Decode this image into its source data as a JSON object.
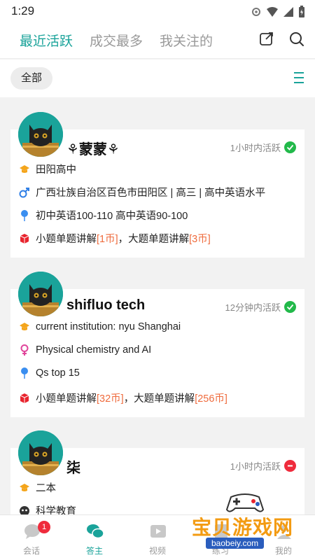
{
  "status_bar": {
    "time": "1:29"
  },
  "top_nav": {
    "tabs": [
      {
        "label": "最近活跃",
        "active": true
      },
      {
        "label": "成交最多",
        "active": false
      },
      {
        "label": "我关注的",
        "active": false
      }
    ],
    "share_icon": "share-icon",
    "search_icon": "search-icon"
  },
  "filter": {
    "chip_label": "全部",
    "menu_icon": "list-icon"
  },
  "colors": {
    "accent": "#1aa39a",
    "online": "#22b94a",
    "offline": "#ef2b3c",
    "price": "#ef6b3d"
  },
  "cards": [
    {
      "name": "⚘蒙蒙⚘",
      "active_time": "1小时内活跃",
      "status": "online",
      "school": "田阳高中",
      "gender": "male",
      "info": "广西壮族自治区百色市田阳区 | 高三 | 高中英语水平",
      "score": "初中英语100-110 高中英语90-100",
      "price_prefix": "小题单题讲解",
      "price1": "[1币]",
      "price_mid": "，大题单题讲解",
      "price2": "[3币]"
    },
    {
      "name": "shifluo tech",
      "active_time": "12分钟内活跃",
      "status": "online",
      "school": "current institution: nyu Shanghai",
      "gender": "female",
      "info": "Physical chemistry and AI",
      "score": "Qs top 15",
      "price_prefix": "小题单题讲解",
      "price1": "[32币]",
      "price_mid": "，大题单题讲解",
      "price2": "[256币]"
    },
    {
      "name": "柒",
      "active_time": "1小时内活跃",
      "status": "offline",
      "school": "二本",
      "subject": "科学教育"
    }
  ],
  "tab_bar": {
    "items": [
      {
        "label": "会话",
        "badge": "1",
        "active": false
      },
      {
        "label": "答主",
        "active": true
      },
      {
        "label": "视频",
        "active": false
      },
      {
        "label": "练习",
        "active": false
      },
      {
        "label": "我的",
        "active": false
      }
    ]
  },
  "watermark": {
    "text": "宝贝游戏网",
    "url": "baobeiy.com"
  }
}
